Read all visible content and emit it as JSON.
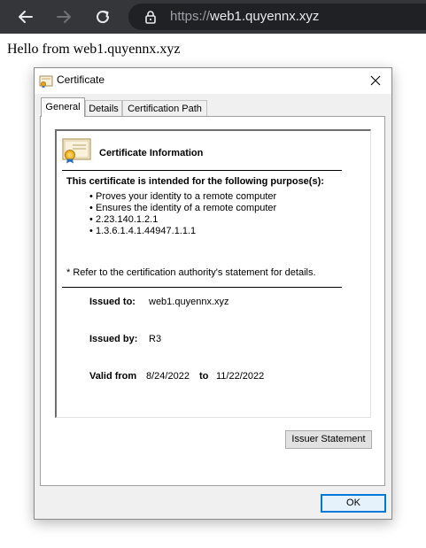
{
  "browser": {
    "back_icon": "back-arrow-icon",
    "forward_icon": "forward-arrow-icon",
    "reload_icon": "reload-icon",
    "lock_icon": "lock-icon",
    "url_protocol": "https://",
    "url_host": "web1.quyennx.xyz"
  },
  "page": {
    "text": "Hello from web1.quyennx.xyz"
  },
  "dialog": {
    "title": "Certificate",
    "title_icon": "certificate-icon",
    "close_icon": "close-icon",
    "tabs": [
      {
        "label": "General",
        "selected": true
      },
      {
        "label": "Details",
        "selected": false
      },
      {
        "label": "Certification Path",
        "selected": false
      }
    ],
    "info": {
      "icon": "certificate-icon",
      "title": "Certificate Information",
      "purpose_heading": "This certificate is intended for the following purpose(s):",
      "purposes": [
        "Proves your identity to a remote computer",
        "Ensures the identity of a remote computer",
        "2.23.140.1.2.1",
        "1.3.6.1.4.1.44947.1.1.1"
      ],
      "note": "* Refer to the certification authority's statement for details.",
      "issued_to_label": "Issued to:",
      "issued_to": "web1.quyennx.xyz",
      "issued_by_label": "Issued by:",
      "issued_by": "R3",
      "valid_from_label": "Valid from",
      "valid_from": "8/24/2022",
      "to_label": "to",
      "valid_to": "11/22/2022"
    },
    "issuer_statement_button": "Issuer Statement",
    "ok_button": "OK"
  },
  "colors": {
    "toolbar_bg": "#35363a",
    "omnibox_bg": "#202124",
    "dialog_bg": "#f0f0f0",
    "accent": "#0078d7"
  }
}
